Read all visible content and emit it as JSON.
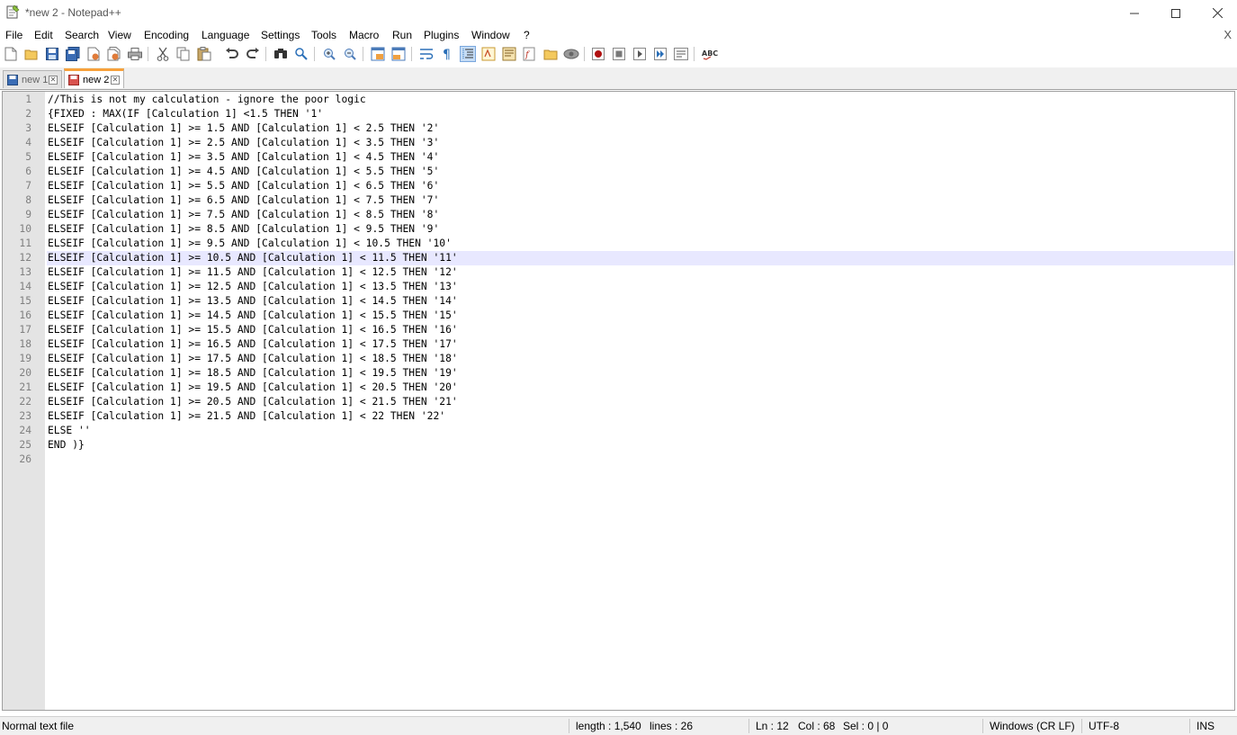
{
  "window": {
    "title": "*new 2 - Notepad++",
    "minimize": "—",
    "maximize": "☐",
    "close": "✕"
  },
  "menu": {
    "items": [
      "File",
      "Edit",
      "Search",
      "View",
      "Encoding",
      "Language",
      "Settings",
      "Tools",
      "Macro",
      "Run",
      "Plugins",
      "Window",
      "?"
    ],
    "close_doc": "X"
  },
  "toolbar": {
    "icons": [
      "new-file-icon",
      "open-file-icon",
      "save-icon",
      "save-all-icon",
      "close-icon",
      "close-all-icon",
      "print-icon",
      "cut-icon",
      "copy-icon",
      "paste-icon",
      "undo-icon",
      "redo-icon",
      "find-icon",
      "replace-icon",
      "zoom-in-icon",
      "zoom-out-icon",
      "sync-vertical-icon",
      "sync-horizontal-icon",
      "word-wrap-icon",
      "show-all-chars-icon",
      "indent-guide-icon",
      "doc-map-icon",
      "function-list-icon",
      "folder-workspace-icon",
      "doc-list-icon",
      "monitoring-icon",
      "record-macro-icon",
      "stop-record-icon",
      "play-macro-icon",
      "run-macro-multiple-icon",
      "save-macro-icon",
      "spell-check-icon"
    ],
    "spell_label": "ABC"
  },
  "tabs": [
    {
      "label": "new 1",
      "active": false
    },
    {
      "label": "new 2",
      "active": true
    }
  ],
  "editor": {
    "current_line": 12,
    "lines": [
      "//This is not my calculation - ignore the poor logic",
      "{FIXED : MAX(IF [Calculation 1] <1.5 THEN '1'",
      "ELSEIF [Calculation 1] >= 1.5 AND [Calculation 1] < 2.5 THEN '2'",
      "ELSEIF [Calculation 1] >= 2.5 AND [Calculation 1] < 3.5 THEN '3'",
      "ELSEIF [Calculation 1] >= 3.5 AND [Calculation 1] < 4.5 THEN '4'",
      "ELSEIF [Calculation 1] >= 4.5 AND [Calculation 1] < 5.5 THEN '5'",
      "ELSEIF [Calculation 1] >= 5.5 AND [Calculation 1] < 6.5 THEN '6'",
      "ELSEIF [Calculation 1] >= 6.5 AND [Calculation 1] < 7.5 THEN '7'",
      "ELSEIF [Calculation 1] >= 7.5 AND [Calculation 1] < 8.5 THEN '8'",
      "ELSEIF [Calculation 1] >= 8.5 AND [Calculation 1] < 9.5 THEN '9'",
      "ELSEIF [Calculation 1] >= 9.5 AND [Calculation 1] < 10.5 THEN '10'",
      "ELSEIF [Calculation 1] >= 10.5 AND [Calculation 1] < 11.5 THEN '11'",
      "ELSEIF [Calculation 1] >= 11.5 AND [Calculation 1] < 12.5 THEN '12'",
      "ELSEIF [Calculation 1] >= 12.5 AND [Calculation 1] < 13.5 THEN '13'",
      "ELSEIF [Calculation 1] >= 13.5 AND [Calculation 1] < 14.5 THEN '14'",
      "ELSEIF [Calculation 1] >= 14.5 AND [Calculation 1] < 15.5 THEN '15'",
      "ELSEIF [Calculation 1] >= 15.5 AND [Calculation 1] < 16.5 THEN '16'",
      "ELSEIF [Calculation 1] >= 16.5 AND [Calculation 1] < 17.5 THEN '17'",
      "ELSEIF [Calculation 1] >= 17.5 AND [Calculation 1] < 18.5 THEN '18'",
      "ELSEIF [Calculation 1] >= 18.5 AND [Calculation 1] < 19.5 THEN '19'",
      "ELSEIF [Calculation 1] >= 19.5 AND [Calculation 1] < 20.5 THEN '20'",
      "ELSEIF [Calculation 1] >= 20.5 AND [Calculation 1] < 21.5 THEN '21'",
      "ELSEIF [Calculation 1] >= 21.5 AND [Calculation 1] < 22 THEN '22'",
      "ELSE ''",
      "END )}",
      ""
    ]
  },
  "status": {
    "file_type": "Normal text file",
    "length": "length : 1,540",
    "lines": "lines : 26",
    "ln": "Ln : 12",
    "col": "Col : 68",
    "sel": "Sel : 0 | 0",
    "eol": "Windows (CR LF)",
    "encoding": "UTF-8",
    "mode": "INS"
  },
  "colors": {
    "current_line": "#e8e8ff",
    "active_tab_accent": "#f7a13b",
    "gutter": "#e4e4e4"
  }
}
